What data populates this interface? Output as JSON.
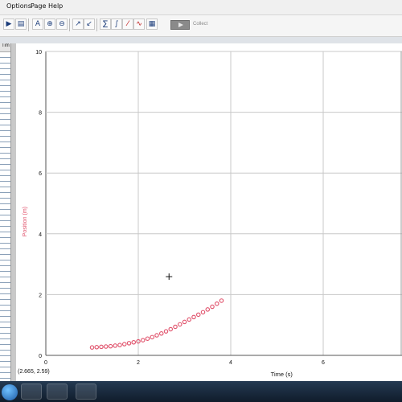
{
  "menu": {
    "items": [
      "Options",
      "Page",
      "Help"
    ]
  },
  "toolbar": {
    "collect_label": "Collect"
  },
  "table": {
    "header": "Tim"
  },
  "coordinate_readout": "(2.665, 2.59)",
  "chart_data": {
    "type": "scatter",
    "xlabel": "Time (s)",
    "ylabel": "Position (m)",
    "xlim": [
      0,
      10
    ],
    "ylim": [
      0,
      10
    ],
    "x_ticks": [
      "0",
      "2",
      "4",
      "6"
    ],
    "y_ticks": [
      "0",
      "2",
      "4",
      "6",
      "8",
      "10"
    ],
    "grid": true,
    "series_color": "#e0506a",
    "cursor": {
      "x": 2.665,
      "y": 2.59
    },
    "series": [
      {
        "x": [
          1.0,
          1.1,
          1.2,
          1.3,
          1.4,
          1.5,
          1.6,
          1.7,
          1.8,
          1.9,
          2.0,
          2.1,
          2.2,
          2.3,
          2.4,
          2.5,
          2.6,
          2.7,
          2.8,
          2.9,
          3.0,
          3.1,
          3.2,
          3.3,
          3.4,
          3.5,
          3.6,
          3.7,
          3.8
        ],
        "y": [
          0.26,
          0.27,
          0.28,
          0.29,
          0.3,
          0.32,
          0.34,
          0.37,
          0.4,
          0.43,
          0.46,
          0.5,
          0.55,
          0.6,
          0.66,
          0.72,
          0.79,
          0.86,
          0.94,
          1.02,
          1.1,
          1.18,
          1.26,
          1.34,
          1.42,
          1.51,
          1.6,
          1.7,
          1.8
        ]
      }
    ]
  }
}
